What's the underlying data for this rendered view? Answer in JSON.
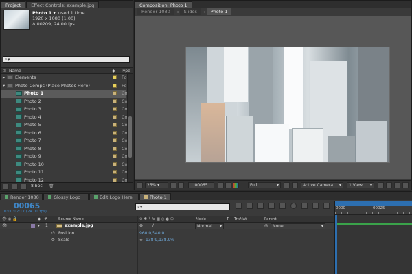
{
  "project_panel": {
    "tabs": [
      "Project",
      "Effect Controls: example.jpg"
    ],
    "item_name": "Photo 1 ▾",
    "item_used": ", used 1 time",
    "item_size": "1920 x 1080 (1.00)",
    "item_time": "Δ 00209, 24.00 fps",
    "search_placeholder": "⌕▾",
    "col_name": "Name",
    "col_type": "Type",
    "rows": [
      {
        "name": "Elements",
        "kind": "folder",
        "expand": "▸",
        "type": "Fo",
        "label": "#e6d05a"
      },
      {
        "name": "Photo Comps (Place Photos Here)",
        "kind": "folder",
        "expand": "▾",
        "type": "Fo",
        "label": "#e6d05a"
      },
      {
        "name": "Photo 1",
        "kind": "comp",
        "type": "Co",
        "label": "#c9b27a",
        "selected": true
      },
      {
        "name": "Photo 2",
        "kind": "comp",
        "type": "Co",
        "label": "#c9b27a"
      },
      {
        "name": "Photo 3",
        "kind": "comp",
        "type": "Co",
        "label": "#c9b27a"
      },
      {
        "name": "Photo 4",
        "kind": "comp",
        "type": "Co",
        "label": "#c9b27a"
      },
      {
        "name": "Photo 5",
        "kind": "comp",
        "type": "Co",
        "label": "#c9b27a"
      },
      {
        "name": "Photo 6",
        "kind": "comp",
        "type": "Co",
        "label": "#c9b27a"
      },
      {
        "name": "Photo 7",
        "kind": "comp",
        "type": "Co",
        "label": "#c9b27a"
      },
      {
        "name": "Photo 8",
        "kind": "comp",
        "type": "Co",
        "label": "#c9b27a"
      },
      {
        "name": "Photo 9",
        "kind": "comp",
        "type": "Co",
        "label": "#c9b27a"
      },
      {
        "name": "Photo 10",
        "kind": "comp",
        "type": "Co",
        "label": "#c9b27a"
      },
      {
        "name": "Photo 11",
        "kind": "comp",
        "type": "Co",
        "label": "#c9b27a"
      },
      {
        "name": "Photo 12",
        "kind": "comp",
        "type": "Co",
        "label": "#c9b27a"
      }
    ],
    "bpc": "8 bpc"
  },
  "composition_panel": {
    "tab": "Composition: Photo 1",
    "subtabs": [
      "Render 1080",
      "Slides",
      "Photo 1"
    ],
    "zoom": "25%",
    "timecode": "00065",
    "resolution": "Full",
    "camera": "Active Camera",
    "views": "1 View"
  },
  "timeline": {
    "tabs": [
      "Render 1080",
      "Glossy Logo",
      "Edit Logo Here",
      "Photo 1"
    ],
    "timecode": "00065",
    "sub_timecode": "0:00:02:17 (24.00 fps)",
    "search_placeholder": "⌕▾",
    "col_source": "Source Name",
    "col_mode": "Mode",
    "col_t": "T",
    "col_trkmat": "TrkMat",
    "col_parent": "Parent",
    "layer_num": "1",
    "layer_name": "example.jpg",
    "layer_mode": "Normal",
    "layer_parent": "None",
    "props": [
      {
        "name": "Position",
        "value": "960.0,540.0"
      },
      {
        "name": "Scale",
        "value": "138.9,138.9%"
      }
    ],
    "ruler_start": "0000",
    "ruler_mark": "00025"
  },
  "colors": {
    "accent_blue": "#6fa8d8",
    "timeline_time": "#3f86c6",
    "work_area": "#2d6fb0",
    "layer_bar": "#3aa24a",
    "selection": "#5b5b5b"
  }
}
